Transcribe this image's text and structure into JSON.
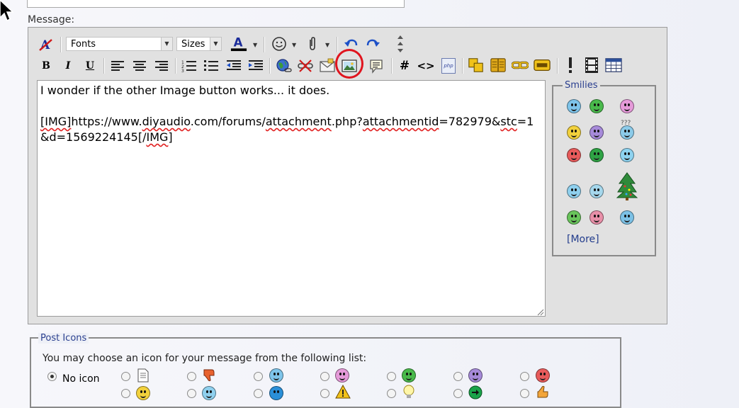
{
  "form": {
    "message_label": "Message:"
  },
  "toolbar": {
    "font_select": "Fonts",
    "size_select": "Sizes",
    "bold": "B",
    "italic": "I",
    "underline": "U",
    "hash": "#",
    "code": "<>",
    "php": "php"
  },
  "editor": {
    "line1": "I wonder if the other Image button works... it does.",
    "img_open": "[IMG]",
    "url_a": "https://www.",
    "url_b": "diyaudio",
    "url_c": ".com/forums/",
    "url_d": "attachment",
    "url_e": ".php?",
    "url_f": "attachmentid",
    "url_g": "=782979&",
    "url_h": "stc",
    "url_i": "=1&d=1569224145[/",
    "url_j": "IMG",
    "url_k": "]"
  },
  "smilies": {
    "legend": "Smilies",
    "more": "[More]",
    "items": [
      {
        "icon": "smile-blue-icon",
        "color": "#7ec4ea"
      },
      {
        "icon": "grin-green-icon",
        "color": "#49b94b"
      },
      {
        "icon": "smile-pink-icon",
        "color": "#e59ad9"
      },
      {
        "icon": "smile-yellow-icon",
        "color": "#f2d13c"
      },
      {
        "icon": "frown-purple-icon",
        "color": "#a68ad9"
      },
      {
        "icon": "confused-blue-icon",
        "color": "#8ccbe9"
      },
      {
        "icon": "mad-red-icon",
        "color": "#e85b5b"
      },
      {
        "icon": "sick-green-icon",
        "color": "#2fa345"
      },
      {
        "icon": "rolleyes-blue-icon",
        "color": "#8ed3f0"
      },
      {
        "icon": "cool-blue-icon",
        "color": "#8fd0ee"
      },
      {
        "icon": "eek-blue-icon",
        "color": "#a5d7ec"
      },
      {
        "icon": "christmas-tree-icon",
        "color": "#2f8a3a"
      },
      {
        "icon": "dizzy-green-icon",
        "color": "#69c45b"
      },
      {
        "icon": "crazy-pink-icon",
        "color": "#e88fa8"
      },
      {
        "icon": "shocked-blue-icon",
        "color": "#7cc1e6"
      }
    ],
    "confused_marks": "???"
  },
  "post_icons": {
    "legend": "Post Icons",
    "description": "You may choose an icon for your message from the following list:",
    "no_icon": "No icon"
  },
  "colors": {
    "highlight_circle": "#e0141e",
    "link_blue": "#223c8c",
    "spell_error": "#e02020"
  }
}
